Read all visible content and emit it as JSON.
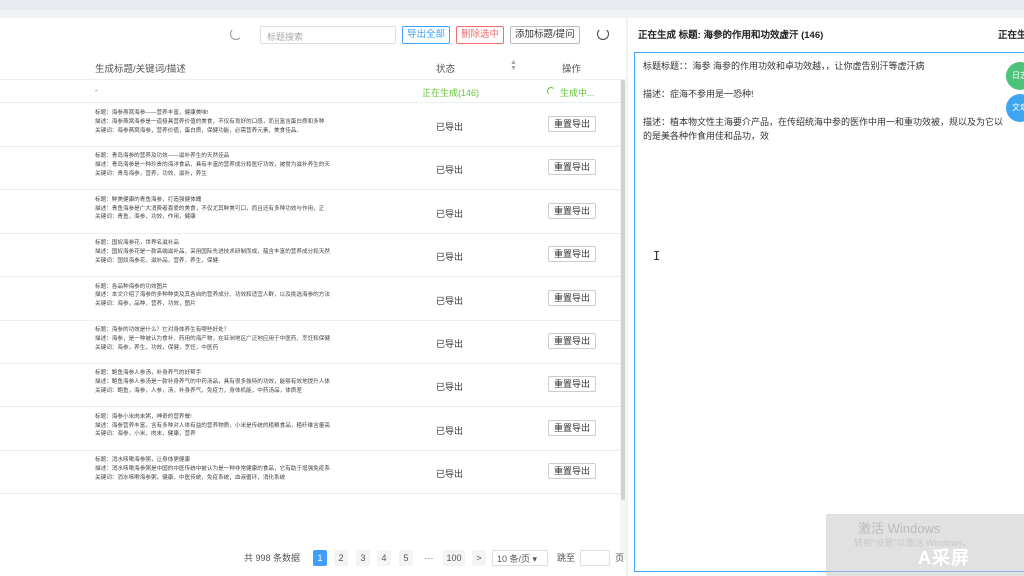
{
  "toolbar": {
    "search_placeholder": "标题搜索",
    "export_all": "导出全部",
    "delete_selected": "删除选中",
    "add_title": "添加标题/提问"
  },
  "table": {
    "col_title": "生成标题/关键词/描述",
    "col_status": "状态",
    "col_op": "操作",
    "generating_row": {
      "title": "-",
      "status": "正在生成(146)",
      "op": "生成中..."
    },
    "rows": [
      {
        "line1": "标题：海参燕窝海参——营养丰富，健康美味!",
        "line2": "描述：海参燕窝海参是一道极具营养价值的美食，不仅有良好的口感，而且富含蛋白质和多种",
        "line3": "关键词：海参燕窝海参，营养价值，蛋白质，保健功能，必需营养元素，美食佳品。",
        "status": "已导出",
        "op": "重置导出"
      },
      {
        "line1": "标题：青岛海参的营养及功效——滋补养生的天然佳品",
        "line2": "描述：青岛海参是一种珍贵的海洋食品，具有丰富的营养成分和医疗功效，被誉为滋补养生的天",
        "line3": "关键词：青岛海参，营养，功效，滋补，养生",
        "status": "已导出",
        "op": "重置导出"
      },
      {
        "line1": "标题：鲜美健康的青鱼海参，打造强健体魄",
        "line2": "描述：青鱼海参是广大消费者喜爱的美食，不仅尤其鲜美可口，而且还有多种功效与作用，正",
        "line3": "关键词：青鱼，海参，功效，作用，健康",
        "status": "已导出",
        "op": "重置导出"
      },
      {
        "line1": "标题：国奴海参花，世界名滋补品",
        "line2": "描述：国奴海参花是一款高端滋补品，采用国际先进技术研制而成，蕴含丰富的营养成分和天然",
        "line3": "关键词：国奴海参花，滋补品，营养，养生，保健",
        "status": "已导出",
        "op": "重置导出"
      },
      {
        "line1": "标题：各品种海参的功效图片",
        "line2": "描述：本文介绍了海参的多种种类及其各自的营养成分、功效和适宜人群，以及挑选海参的方法",
        "line3": "关键词：海参，品种，营养，功效，图片",
        "status": "已导出",
        "op": "重置导出"
      },
      {
        "line1": "标题：海参的功效是什么？它对身体养生有哪些好处？",
        "line2": "描述：海参，是一种被认为食补、药用的海产物，在亚洲地区广泛地应用于中医药、烹饪和保健",
        "line3": "关键词：海参，养生，功效，保健，烹饪，中医药",
        "status": "已导出",
        "op": "重置导出"
      },
      {
        "line1": "标题：鲍鱼海参人参汤，补身养气的好帮手",
        "line2": "描述：鲍鱼海参人参汤是一款补身养气的中药汤品，具有很多独特的功效，能够有效地提升人体",
        "line3": "关键词：鲍鱼，海参，人参，汤，补身养气，免疫力，身体机能，中药汤品，体质差",
        "status": "已导出",
        "op": "重置导出"
      },
      {
        "line1": "标题：海参小米肉末粥，神奇的营养餐!",
        "line2": "描述：海参营养丰富，含有多种对人体有益的营养物质，小米是传统的粗粮食品，粗纤维含量高",
        "line3": "关键词：海参，小米，肉末，健康，营养",
        "status": "已导出",
        "op": "重置导出"
      },
      {
        "line1": "标题：消水咳嗽海参粥，让身体更健康",
        "line2": "描述：消水咳嗽海参粥是中国的中医传统中被认为是一种非常健康的食品，它有助于增强免疫系",
        "line3": "关键词：消水咳嗽海参粥，健康，中医传统，免疫系统，血液循环，消化系统",
        "status": "已导出",
        "op": "重置导出"
      }
    ]
  },
  "pager": {
    "total": "共 998 条数据",
    "pages": [
      "1",
      "2",
      "3",
      "4",
      "5",
      "···",
      "100"
    ],
    "next": ">",
    "size": "10 条/页 ▾",
    "jump_label": "跳至",
    "page_label": "页"
  },
  "right": {
    "header": "正在生成 标题: 海参的作用和功效虚汗 (146)",
    "header_cut": "正在生成",
    "para1": "标题标题：：海参 海参的作用功效和卓功效越，，让你虚告别汗等虚汗病",
    "para2": "描述：症海不参用是一恐种!",
    "para3": "描述：植本物文性主海要介产品，在传绍统海中参的医作中用一和重功效被，规以及为它以的是美各种作食用佳和品功，效",
    "para3_line1": "描述：植本物文性主海要介产品，在传绍统海中参的医作中用一和重功效被，规以及为它以",
    "para3_line2": "的是美各种作食用佳和品功，效",
    "fab1": "日志",
    "fab2": "文章"
  },
  "watermark": {
    "title": "激活 Windows",
    "sub": "转到\"设置\"以激活 Windows。",
    "logo": "A采屏"
  }
}
